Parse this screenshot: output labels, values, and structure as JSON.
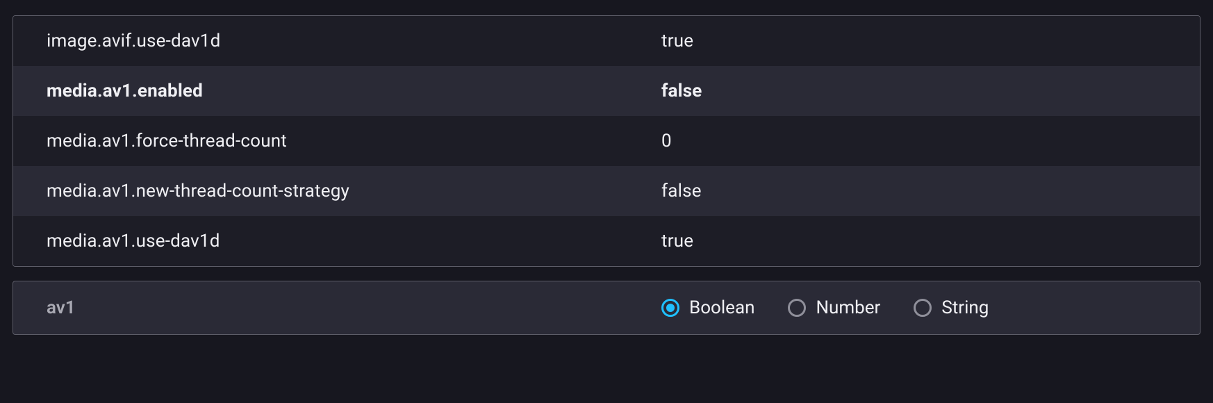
{
  "prefs": [
    {
      "name": "image.avif.use-dav1d",
      "value": "true",
      "modified": false
    },
    {
      "name": "media.av1.enabled",
      "value": "false",
      "modified": true
    },
    {
      "name": "media.av1.force-thread-count",
      "value": "0",
      "modified": false
    },
    {
      "name": "media.av1.new-thread-count-strategy",
      "value": "false",
      "modified": false
    },
    {
      "name": "media.av1.use-dav1d",
      "value": "true",
      "modified": false
    }
  ],
  "new_pref": {
    "name": "av1",
    "types": [
      {
        "label": "Boolean",
        "checked": true
      },
      {
        "label": "Number",
        "checked": false
      },
      {
        "label": "String",
        "checked": false
      }
    ]
  }
}
